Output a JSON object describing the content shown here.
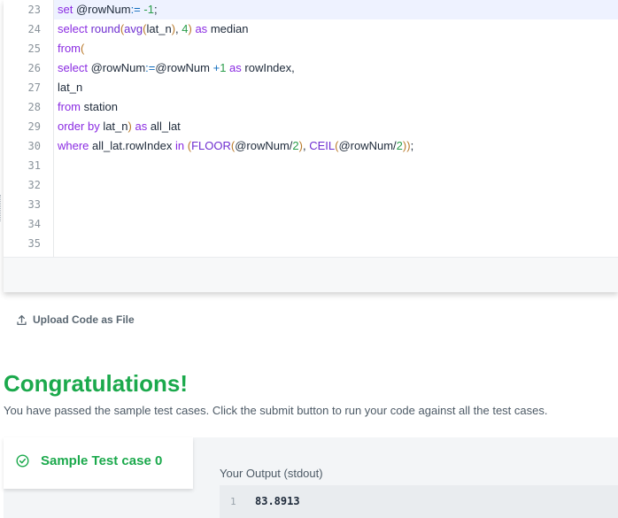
{
  "editor": {
    "line_numbers": [
      "23",
      "24",
      "25",
      "26",
      "27",
      "28",
      "29",
      "30",
      "31",
      "32",
      "33",
      "34",
      "35"
    ],
    "lines": [
      {
        "segments": [
          [
            "kw",
            "set "
          ],
          [
            "",
            "@rowNum"
          ],
          [
            "op",
            ":= "
          ],
          [
            "num",
            "-1"
          ],
          [
            "",
            ";"
          ]
        ]
      },
      {
        "segments": [
          [
            "kw",
            "select "
          ],
          [
            "fn",
            "round"
          ],
          [
            "par",
            "("
          ],
          [
            "fn",
            "avg"
          ],
          [
            "par",
            "("
          ],
          [
            "",
            "lat_n"
          ],
          [
            "par",
            ")"
          ],
          [
            "",
            ", "
          ],
          [
            "num",
            "4"
          ],
          [
            "par",
            ")"
          ],
          [
            "kw",
            " as "
          ],
          [
            "",
            "median"
          ]
        ]
      },
      {
        "segments": [
          [
            "kw",
            "from"
          ],
          [
            "par",
            "("
          ]
        ]
      },
      {
        "segments": [
          [
            "kw",
            "select "
          ],
          [
            "",
            "@rowNum"
          ],
          [
            "op",
            ":="
          ],
          [
            "",
            "@rowNum "
          ],
          [
            "op",
            "+"
          ],
          [
            "num",
            "1"
          ],
          [
            "kw",
            " as "
          ],
          [
            "",
            "rowIndex,"
          ]
        ]
      },
      {
        "segments": [
          [
            "",
            "lat_n"
          ]
        ]
      },
      {
        "segments": [
          [
            "kw",
            "from "
          ],
          [
            "",
            "station"
          ]
        ]
      },
      {
        "segments": [
          [
            "kw",
            "order by "
          ],
          [
            "",
            "lat_n"
          ],
          [
            "par",
            ")"
          ],
          [
            "kw",
            " as "
          ],
          [
            "",
            "all_lat"
          ]
        ]
      },
      {
        "segments": [
          [
            "kw",
            "where "
          ],
          [
            "",
            "all_lat.rowIndex "
          ],
          [
            "kw",
            "in "
          ],
          [
            "par",
            "("
          ],
          [
            "fn",
            "FLOOR"
          ],
          [
            "par",
            "("
          ],
          [
            "",
            "@rowNum/"
          ],
          [
            "num",
            "2"
          ],
          [
            "par",
            ")"
          ],
          [
            "",
            ", "
          ],
          [
            "fn",
            "CEIL"
          ],
          [
            "par",
            "("
          ],
          [
            "",
            "@rowNum/"
          ],
          [
            "num",
            "2"
          ],
          [
            "par",
            "))"
          ],
          [
            "",
            ";"
          ]
        ]
      },
      {
        "segments": []
      },
      {
        "segments": []
      },
      {
        "segments": []
      },
      {
        "segments": []
      },
      {
        "segments": []
      }
    ]
  },
  "upload": {
    "label": "Upload Code as File"
  },
  "result": {
    "title": "Congratulations!",
    "message": "You have passed the sample test cases. Click the submit button to run your code against all the test cases."
  },
  "testcase": {
    "name": "Sample Test case 0",
    "output_label": "Your Output (stdout)",
    "output_line_no": "1",
    "output_value": "83.8913"
  },
  "colors": {
    "success": "#1ba94c",
    "keyword": "#8a2be2",
    "number": "#2a9d4a"
  },
  "icons": {
    "upload": "upload-icon",
    "check": "check-circle-icon"
  }
}
